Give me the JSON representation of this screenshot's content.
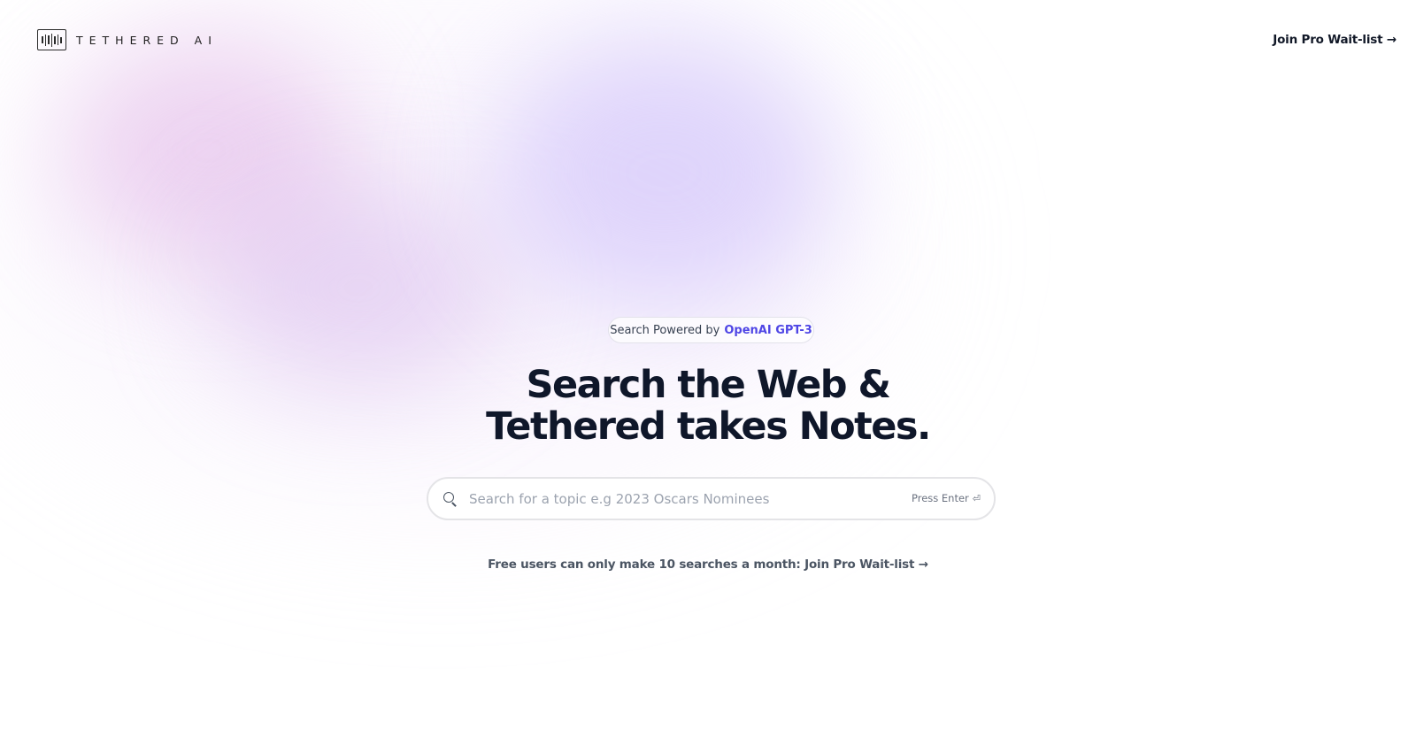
{
  "header": {
    "logo_text": "TETHERED AI",
    "logo_icon": "waveform-box-icon",
    "cta_label": "Join Pro Wait-list →"
  },
  "hero": {
    "badge_prefix": "Search Powered by",
    "badge_brand": "OpenAI GPT-3",
    "headline_line1": "Search the Web &",
    "headline_line2": "Tethered takes Notes."
  },
  "search": {
    "icon": "search-icon",
    "placeholder": "Search for a topic e.g 2023 Oscars Nominees",
    "value": "",
    "hint_label": "Press Enter",
    "hint_icon": "enter-key-icon"
  },
  "footer_note": {
    "text": "Free users can only make 10 searches a month: Join Pro Wait-list →"
  },
  "colors": {
    "brand_accent": "#4f46e5",
    "heading": "#0f172a",
    "muted": "#4b5563",
    "blob_pink": "#e2b7e8",
    "blob_violet": "#cdbefa"
  }
}
